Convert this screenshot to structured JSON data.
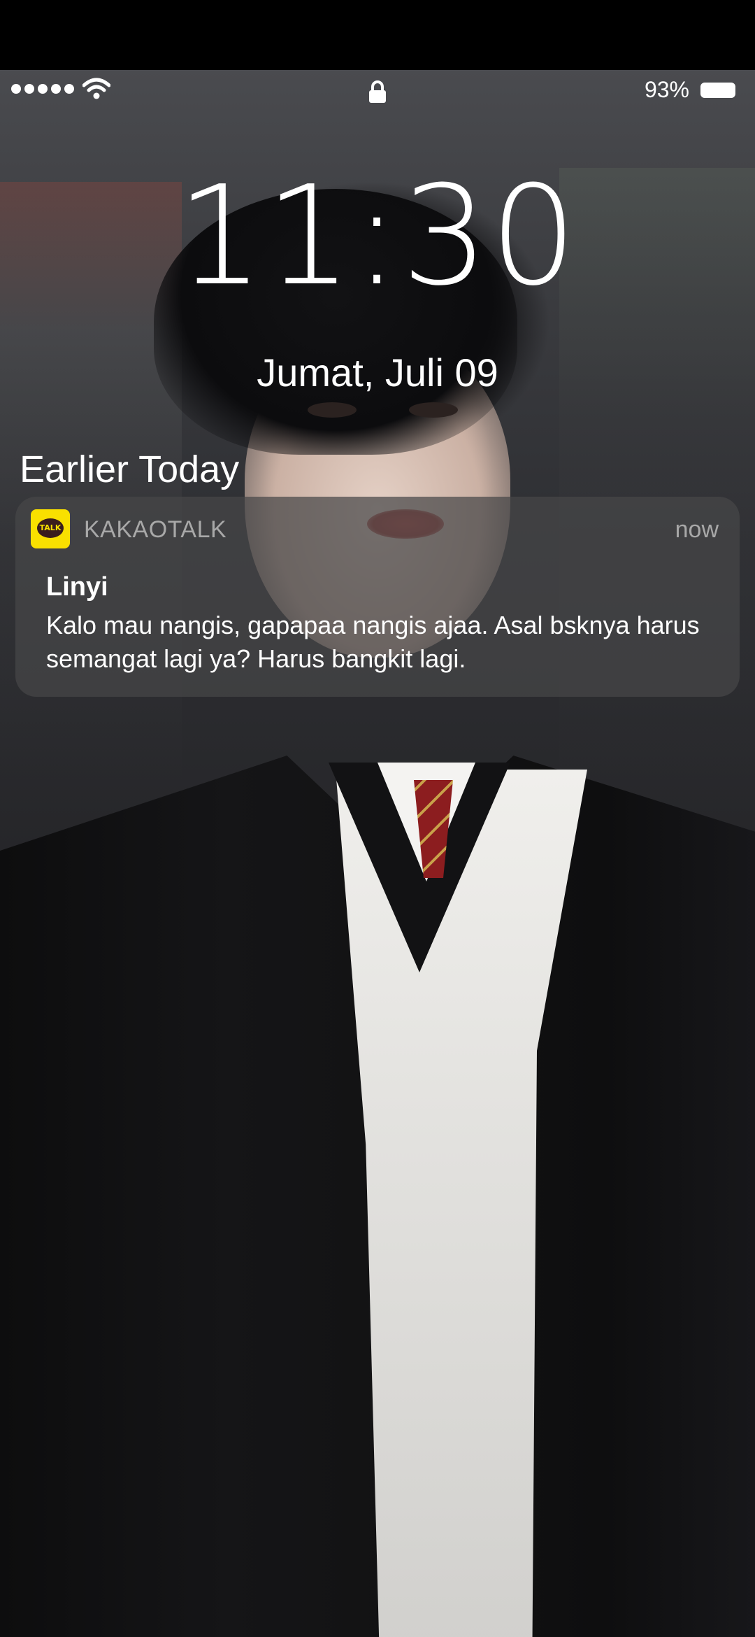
{
  "status_bar": {
    "signal_icon": "signal-dots-icon",
    "wifi_icon": "wifi-icon",
    "lock_icon": "lock-icon",
    "battery_percent": "93%",
    "battery_icon": "battery-icon"
  },
  "lock_screen": {
    "time": "11:30",
    "date": "Jumat, Juli 09"
  },
  "notifications": {
    "section_title": "Earlier Today",
    "items": [
      {
        "app_icon": "kakaotalk-icon",
        "app_icon_text": "TALK",
        "app_name": "KAKAOTALK",
        "time": "now",
        "sender": "Linyi",
        "message": "Kalo mau nangis, gapapaa nangis ajaa. Asal bsknya harus semangat lagi ya? Harus bangkit lagi."
      }
    ]
  },
  "colors": {
    "kakaotalk_yellow": "#f9e000",
    "notification_bg": "#464648",
    "secondary_text": "#a8a8a8"
  }
}
